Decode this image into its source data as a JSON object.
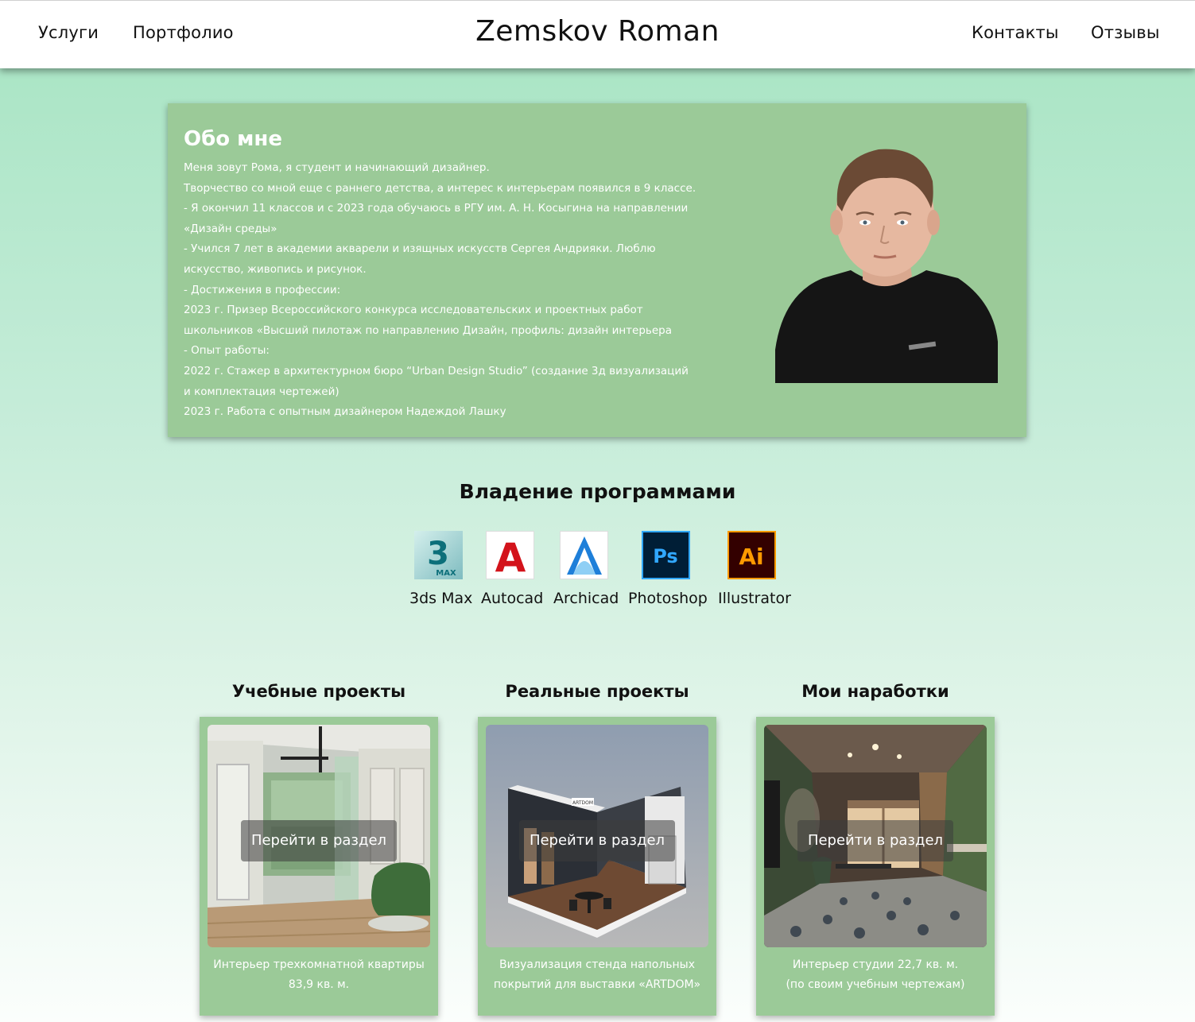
{
  "header": {
    "nav_left": [
      "Услуги",
      "Портфолио"
    ],
    "title": "Zemskov Roman",
    "nav_right": [
      "Контакты",
      "Отзывы"
    ]
  },
  "about": {
    "title": "Обо мне",
    "lines": [
      "Меня зовут Рома, я студент и начинающий дизайнер.",
      "Творчество со мной еще с раннего детства, а интерес к интерьерам появился в 9 классе.",
      "-  Я окончил 11 классов и с 2023 года обучаюсь в РГУ им. А. Н. Косыгина на направлении",
      "«Дизайн среды»",
      "-  Учился 7 лет в академии акварели и изящных искусств Сергея Андрияки. Люблю",
      "искусство, живопись и рисунок.",
      "-  Достижения в профессии:",
      "2023 г. Призер Всероссийского конкурса исследовательских и проектных работ",
      "школьников «Высший пилотаж по направлению Дизайн, профиль: дизайн интерьера",
      "-  Опыт работы:",
      "2022 г. Стажер в архитектурном бюро “Urban Design Studio” (создание 3д визуализаций",
      "и комплектация чертежей)",
      "2023 г. Работа с опытным дизайнером Надеждой Лашку"
    ]
  },
  "software": {
    "title": "Владение программами",
    "items": [
      {
        "label": "3ds Max",
        "icon": "3ds-max-icon",
        "glyph": "3",
        "sub": "MAX"
      },
      {
        "label": "Autocad",
        "icon": "autocad-icon",
        "glyph": "A"
      },
      {
        "label": "Archicad",
        "icon": "archicad-icon",
        "glyph": "A"
      },
      {
        "label": "Photoshop",
        "icon": "photoshop-icon",
        "glyph": "Ps"
      },
      {
        "label": "Illustrator",
        "icon": "illustrator-icon",
        "glyph": "Ai"
      }
    ]
  },
  "projects": [
    {
      "title": "Учебные проекты",
      "button": "Перейти в раздел",
      "caption": [
        "Интерьер трехкомнатной квартиры",
        "83,9 кв. м."
      ]
    },
    {
      "title": "Реальные проекты",
      "button": "Перейти в раздел",
      "caption": [
        "Визуализация стенда напольных",
        "покрытий для выставки «ARTDOM»"
      ]
    },
    {
      "title": "Мои наработки",
      "button": "Перейти в раздел",
      "caption": [
        "Интерьер студии 22,7 кв. м.",
        "(по своим учебным чертежам)"
      ]
    }
  ],
  "stand_brand": "ARTDOM",
  "colors": {
    "card_green": "#9bca98",
    "bg_top": "#a6e4c2",
    "photoshop_blue": "#31a8ff",
    "illustrator_orange": "#ff9a00",
    "autocad_red": "#d3131b"
  }
}
